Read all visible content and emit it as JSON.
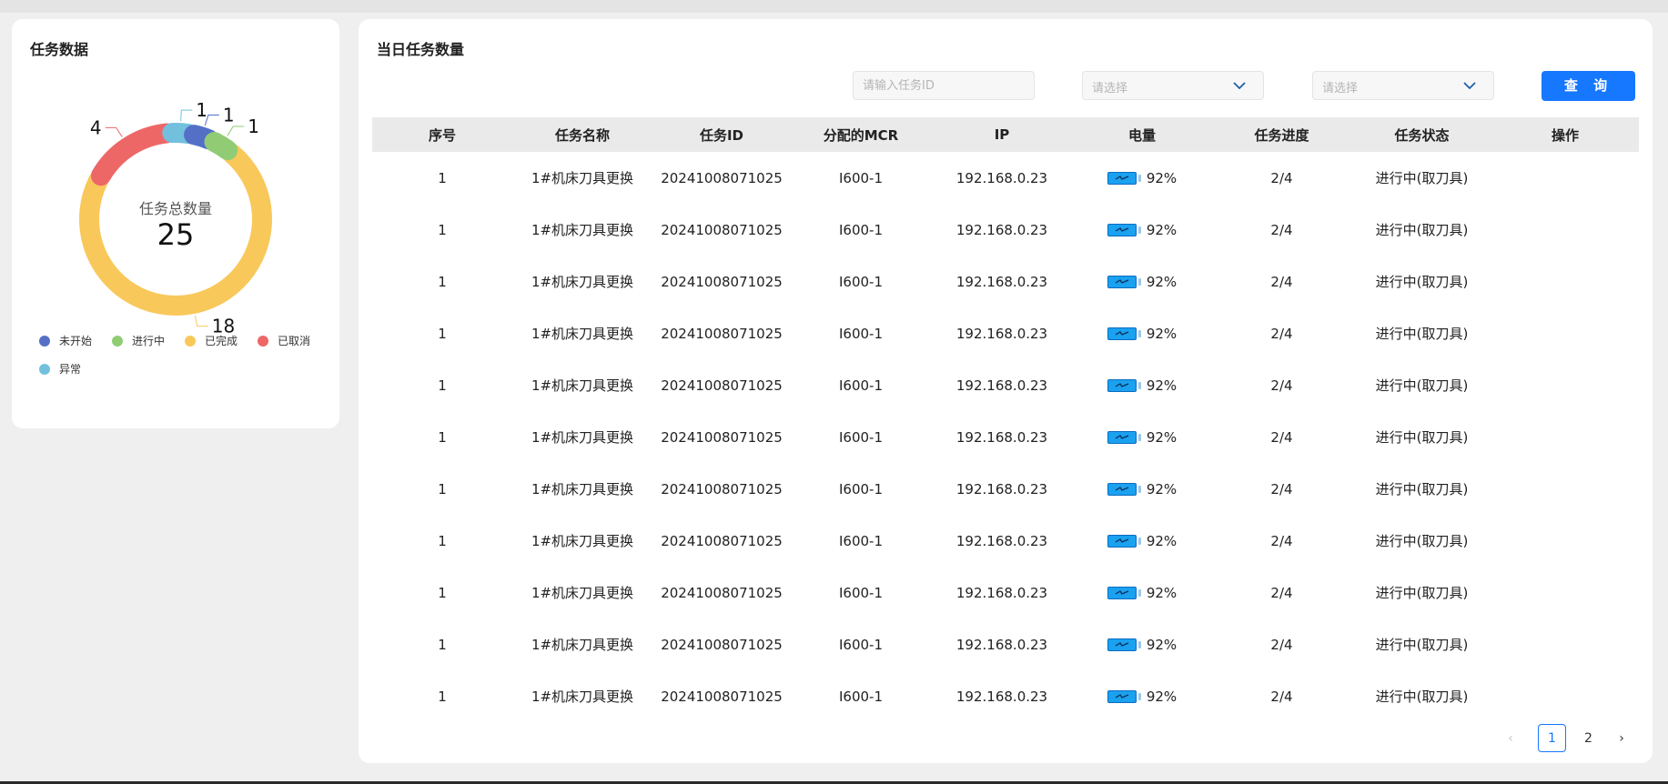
{
  "left_panel": {
    "title": "任务数据",
    "donut": {
      "center_label": "任务总数量",
      "total": "25",
      "segments": [
        {
          "name": "已完成",
          "value": 18,
          "color": "#f9c85b"
        },
        {
          "name": "已取消",
          "value": 4,
          "color": "#ee6767"
        },
        {
          "name": "异常",
          "value": 1,
          "color": "#73c0de"
        },
        {
          "name": "未开始",
          "value": 1,
          "color": "#5470c6"
        },
        {
          "name": "进行中",
          "value": 1,
          "color": "#91cc75"
        }
      ]
    },
    "legend": [
      {
        "label": "未开始",
        "color": "#5470c6"
      },
      {
        "label": "进行中",
        "color": "#91cc75"
      },
      {
        "label": "已完成",
        "color": "#f9c85b"
      },
      {
        "label": "已取消",
        "color": "#ee6767"
      },
      {
        "label": "异常",
        "color": "#73c0de"
      }
    ]
  },
  "right_panel": {
    "title": "当日任务数量",
    "filters": {
      "task_id_placeholder": "请输入任务ID",
      "select1_placeholder": "请选择",
      "select2_placeholder": "请选择",
      "query_label": "查 询"
    },
    "table": {
      "headers": [
        "序号",
        "任务名称",
        "任务ID",
        "分配的MCR",
        "IP",
        "电量",
        "任务进度",
        "任务状态",
        "操作"
      ],
      "rows": [
        {
          "idx": "1",
          "name": "1#机床刀具更换",
          "task_id": "20241008071025",
          "mcr": "I600-1",
          "ip": "192.168.0.23",
          "battery": "92%",
          "progress": "2/4",
          "status": "进行中(取刀具)",
          "op": ""
        },
        {
          "idx": "1",
          "name": "1#机床刀具更换",
          "task_id": "20241008071025",
          "mcr": "I600-1",
          "ip": "192.168.0.23",
          "battery": "92%",
          "progress": "2/4",
          "status": "进行中(取刀具)",
          "op": ""
        },
        {
          "idx": "1",
          "name": "1#机床刀具更换",
          "task_id": "20241008071025",
          "mcr": "I600-1",
          "ip": "192.168.0.23",
          "battery": "92%",
          "progress": "2/4",
          "status": "进行中(取刀具)",
          "op": ""
        },
        {
          "idx": "1",
          "name": "1#机床刀具更换",
          "task_id": "20241008071025",
          "mcr": "I600-1",
          "ip": "192.168.0.23",
          "battery": "92%",
          "progress": "2/4",
          "status": "进行中(取刀具)",
          "op": ""
        },
        {
          "idx": "1",
          "name": "1#机床刀具更换",
          "task_id": "20241008071025",
          "mcr": "I600-1",
          "ip": "192.168.0.23",
          "battery": "92%",
          "progress": "2/4",
          "status": "进行中(取刀具)",
          "op": ""
        },
        {
          "idx": "1",
          "name": "1#机床刀具更换",
          "task_id": "20241008071025",
          "mcr": "I600-1",
          "ip": "192.168.0.23",
          "battery": "92%",
          "progress": "2/4",
          "status": "进行中(取刀具)",
          "op": ""
        },
        {
          "idx": "1",
          "name": "1#机床刀具更换",
          "task_id": "20241008071025",
          "mcr": "I600-1",
          "ip": "192.168.0.23",
          "battery": "92%",
          "progress": "2/4",
          "status": "进行中(取刀具)",
          "op": ""
        },
        {
          "idx": "1",
          "name": "1#机床刀具更换",
          "task_id": "20241008071025",
          "mcr": "I600-1",
          "ip": "192.168.0.23",
          "battery": "92%",
          "progress": "2/4",
          "status": "进行中(取刀具)",
          "op": ""
        },
        {
          "idx": "1",
          "name": "1#机床刀具更换",
          "task_id": "20241008071025",
          "mcr": "I600-1",
          "ip": "192.168.0.23",
          "battery": "92%",
          "progress": "2/4",
          "status": "进行中(取刀具)",
          "op": ""
        },
        {
          "idx": "1",
          "name": "1#机床刀具更换",
          "task_id": "20241008071025",
          "mcr": "I600-1",
          "ip": "192.168.0.23",
          "battery": "92%",
          "progress": "2/4",
          "status": "进行中(取刀具)",
          "op": ""
        },
        {
          "idx": "1",
          "name": "1#机床刀具更换",
          "task_id": "20241008071025",
          "mcr": "I600-1",
          "ip": "192.168.0.23",
          "battery": "92%",
          "progress": "2/4",
          "status": "进行中(取刀具)",
          "op": ""
        }
      ]
    },
    "pagination": {
      "prev": "‹",
      "pages": [
        "1",
        "2"
      ],
      "current": "1",
      "next": "›"
    }
  }
}
